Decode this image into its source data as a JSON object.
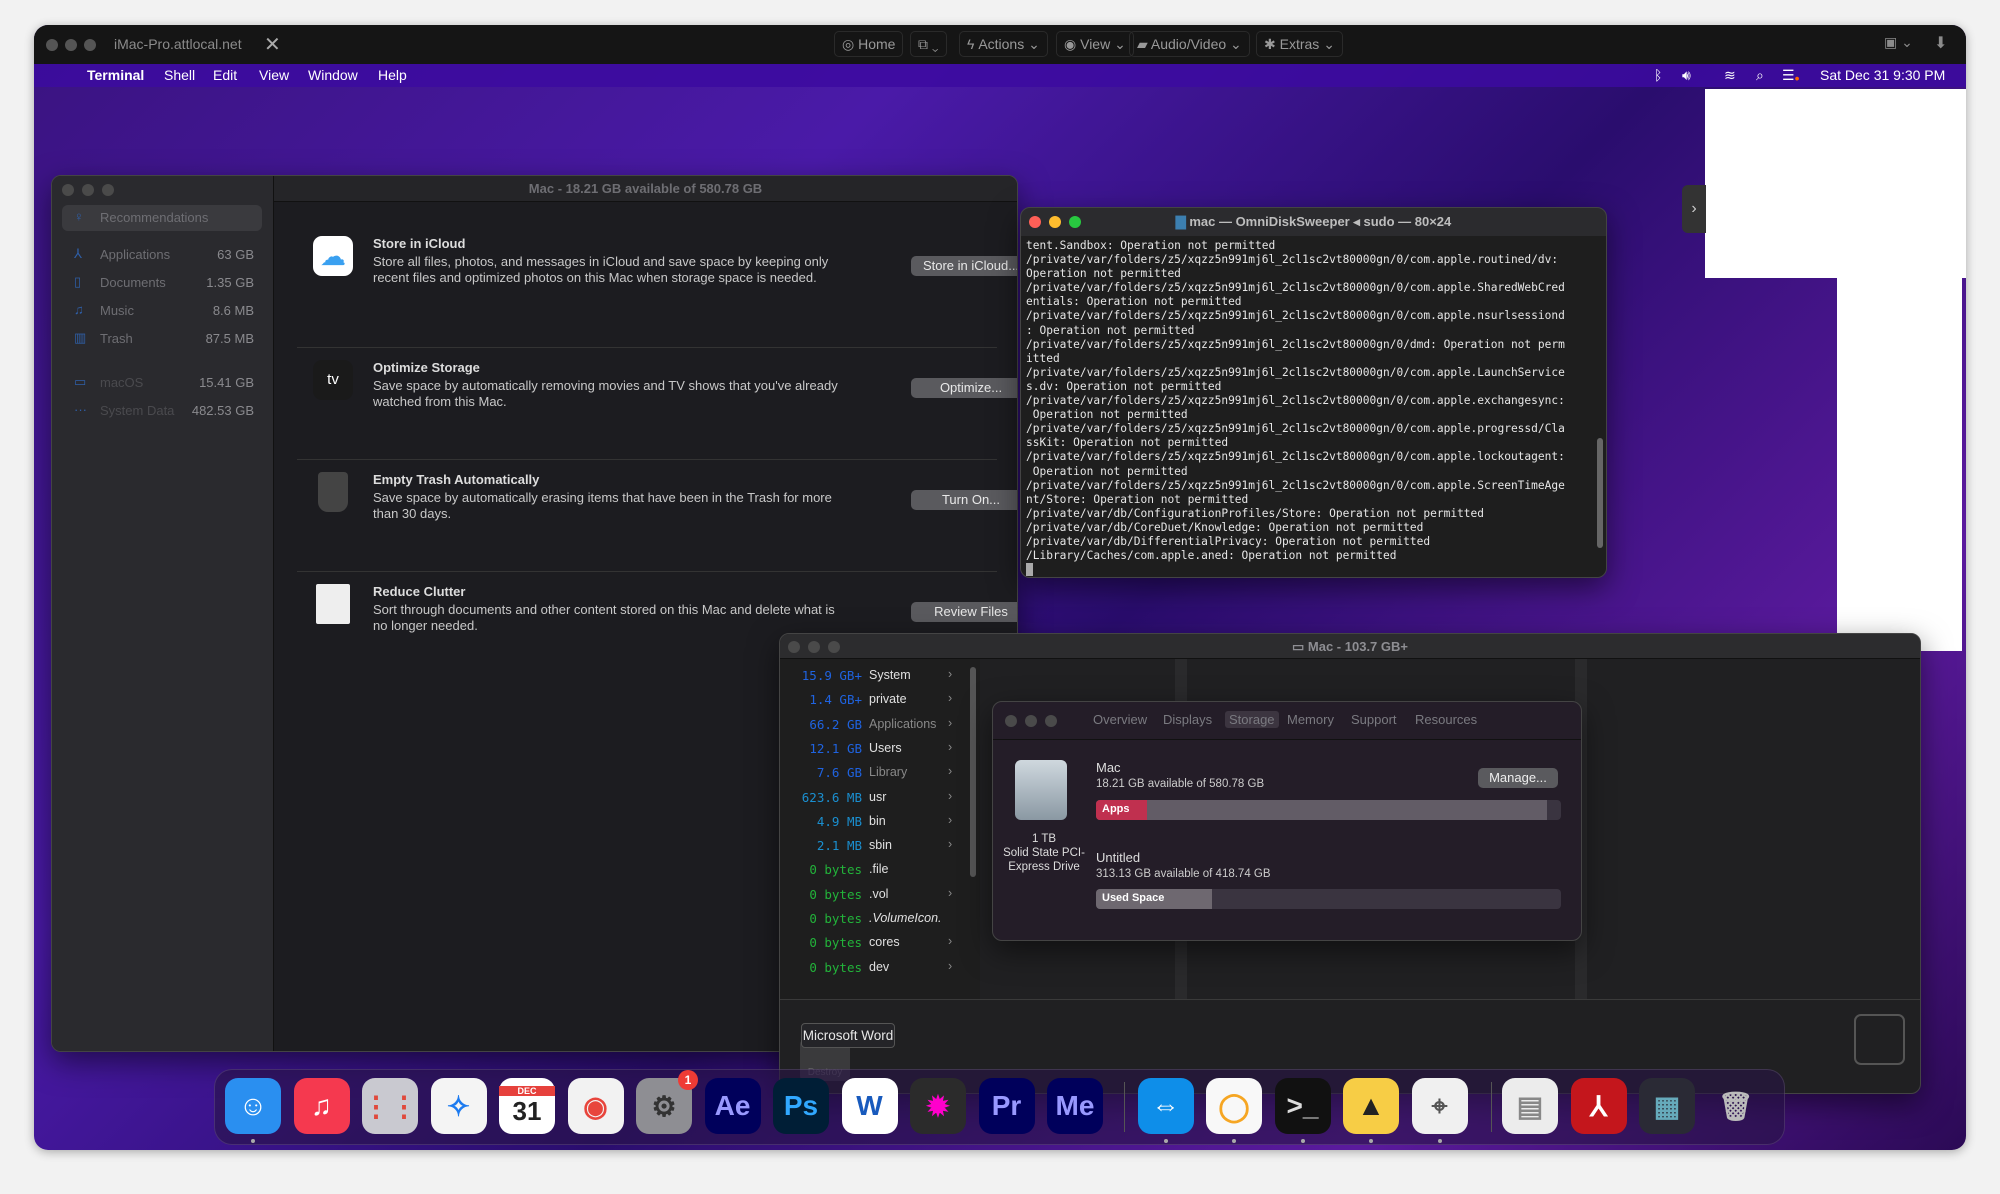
{
  "toolbar": {
    "host": "iMac-Pro.attlocal.net",
    "close_glyph": "✕",
    "home": "Home",
    "actions": "Actions",
    "view": "View",
    "audio_video": "Audio/Video",
    "extras": "Extras"
  },
  "menubar": {
    "app": "Terminal",
    "items": [
      "Shell",
      "Edit",
      "View",
      "Window",
      "Help"
    ],
    "clock": "Sat Dec 31  9:30 PM"
  },
  "storage_manager": {
    "title": "Mac - 18.21 GB available of 580.78 GB",
    "sidebar": [
      {
        "label": "Recommendations",
        "size": "",
        "icon": "lightbulb-icon"
      },
      {
        "label": "Applications",
        "size": "63 GB",
        "icon": "app-store-icon"
      },
      {
        "label": "Documents",
        "size": "1.35 GB",
        "icon": "document-icon"
      },
      {
        "label": "Music",
        "size": "8.6 MB",
        "icon": "music-note-icon"
      },
      {
        "label": "Trash",
        "size": "87.5 MB",
        "icon": "trash-icon"
      },
      {
        "label": "macOS",
        "size": "15.41 GB",
        "icon": "monitor-icon"
      },
      {
        "label": "System Data",
        "size": "482.53 GB",
        "icon": "ellipsis-icon"
      }
    ],
    "recommendations": [
      {
        "title": "Store in iCloud",
        "desc": "Store all files, photos, and messages in iCloud and save space by keeping only recent files and optimized photos on this Mac when storage space is needed.",
        "button": "Store in iCloud..."
      },
      {
        "title": "Optimize Storage",
        "desc": "Save space by automatically removing movies and TV shows that you've already watched from this Mac.",
        "button": "Optimize...",
        "icon_text": "tv"
      },
      {
        "title": "Empty Trash Automatically",
        "desc": "Save space by automatically erasing items that have been in the Trash for more than 30 days.",
        "button": "Turn On..."
      },
      {
        "title": "Reduce Clutter",
        "desc": "Sort through documents and other content stored on this Mac and delete what is no longer needed.",
        "button": "Review Files"
      }
    ]
  },
  "terminal": {
    "title": "mac — OmniDiskSweeper ◂ sudo — 80×24",
    "lines": [
      "tent.Sandbox: Operation not permitted",
      "/private/var/folders/z5/xqzz5n991mj6l_2cl1sc2vt80000gn/0/com.apple.routined/dv:",
      "Operation not permitted",
      "/private/var/folders/z5/xqzz5n991mj6l_2cl1sc2vt80000gn/0/com.apple.SharedWebCred",
      "entials: Operation not permitted",
      "/private/var/folders/z5/xqzz5n991mj6l_2cl1sc2vt80000gn/0/com.apple.nsurlsessiond",
      ": Operation not permitted",
      "/private/var/folders/z5/xqzz5n991mj6l_2cl1sc2vt80000gn/0/dmd: Operation not perm",
      "itted",
      "/private/var/folders/z5/xqzz5n991mj6l_2cl1sc2vt80000gn/0/com.apple.LaunchService",
      "s.dv: Operation not permitted",
      "/private/var/folders/z5/xqzz5n991mj6l_2cl1sc2vt80000gn/0/com.apple.exchangesync:",
      " Operation not permitted",
      "/private/var/folders/z5/xqzz5n991mj6l_2cl1sc2vt80000gn/0/com.apple.progressd/Cla",
      "ssKit: Operation not permitted",
      "/private/var/folders/z5/xqzz5n991mj6l_2cl1sc2vt80000gn/0/com.apple.lockoutagent:",
      " Operation not permitted",
      "/private/var/folders/z5/xqzz5n991mj6l_2cl1sc2vt80000gn/0/com.apple.ScreenTimeAge",
      "nt/Store: Operation not permitted",
      "/private/var/db/ConfigurationProfiles/Store: Operation not permitted",
      "/private/var/db/CoreDuet/Knowledge: Operation not permitted",
      "/private/var/db/DifferentialPrivacy: Operation not permitted",
      "/Library/Caches/com.apple.aned: Operation not permitted"
    ]
  },
  "omnidisksweeper": {
    "title": "Mac - 103.7 GB+",
    "rows": [
      {
        "size": "15.9 GB+",
        "name": "System",
        "color": "#1f63e0",
        "dim": false,
        "chevron": true
      },
      {
        "size": "1.4 GB+",
        "name": "private",
        "color": "#1f63e0",
        "dim": false,
        "chevron": true
      },
      {
        "size": "66.2 GB",
        "name": "Applications",
        "color": "#1f63e0",
        "dim": true,
        "chevron": true
      },
      {
        "size": "12.1 GB",
        "name": "Users",
        "color": "#1f63e0",
        "dim": false,
        "chevron": true
      },
      {
        "size": "7.6 GB",
        "name": "Library",
        "color": "#1f63e0",
        "dim": true,
        "chevron": true
      },
      {
        "size": "623.6 MB",
        "name": "usr",
        "color": "#1a8fd0",
        "dim": false,
        "chevron": true
      },
      {
        "size": "4.9 MB",
        "name": "bin",
        "color": "#1a8fd0",
        "dim": false,
        "chevron": true
      },
      {
        "size": "2.1 MB",
        "name": "sbin",
        "color": "#1a8fd0",
        "dim": false,
        "chevron": true
      },
      {
        "size": "0 bytes",
        "name": ".file",
        "color": "#22b33a",
        "dim": false,
        "chevron": false
      },
      {
        "size": "0 bytes",
        "name": ".vol",
        "color": "#22b33a",
        "dim": false,
        "chevron": true
      },
      {
        "size": "0 bytes",
        "name": ".VolumeIcon.",
        "color": "#22b33a",
        "dim": false,
        "chevron": false
      },
      {
        "size": "0 bytes",
        "name": "cores",
        "color": "#22b33a",
        "dim": false,
        "chevron": true
      },
      {
        "size": "0 bytes",
        "name": "dev",
        "color": "#22b33a",
        "dim": false,
        "chevron": true
      }
    ]
  },
  "about_mac": {
    "tabs": [
      "Overview",
      "Displays",
      "Storage",
      "Memory",
      "Support",
      "Resources"
    ],
    "active_tab": "Storage",
    "drive_caption": [
      "1 TB",
      "Solid State PCI-",
      "Express Drive"
    ],
    "volumes": [
      {
        "name": "Mac",
        "avail": "18.21 GB available of 580.78 GB",
        "bar_label": "Apps",
        "used_fraction": 0.97,
        "apps_fraction": 0.11,
        "color": "#c0304f"
      },
      {
        "name": "Untitled",
        "avail": "313.13 GB available of 418.74 GB",
        "bar_label": "Used Space",
        "used_fraction": 0.25
      }
    ],
    "manage": "Manage..."
  },
  "tooltip": "Microsoft Word",
  "dock": [
    {
      "name": "Finder",
      "glyph": "☺",
      "bg": "#2a8ff0",
      "fg": "#fff",
      "running": true
    },
    {
      "name": "Music",
      "glyph": "♫",
      "bg": "#f5394f",
      "fg": "#fff",
      "running": false
    },
    {
      "name": "Launchpad",
      "glyph": "⋮⋮",
      "bg": "#c9c9d0",
      "fg": "#e0493c",
      "running": false
    },
    {
      "name": "Safari",
      "glyph": "✧",
      "bg": "#f4f4f4",
      "fg": "#1d7bf0",
      "running": false
    },
    {
      "name": "Calendar",
      "glyph": "31",
      "bg": "#ffffff",
      "fg": "#222",
      "running": false,
      "month": "DEC"
    },
    {
      "name": "Chrome",
      "glyph": "◉",
      "bg": "#f2f2f2",
      "fg": "#e8453c",
      "running": false
    },
    {
      "name": "System Preferences",
      "glyph": "⚙",
      "bg": "#8e8e93",
      "fg": "#333",
      "running": false,
      "badge": "1"
    },
    {
      "name": "After Effects",
      "glyph": "Ae",
      "bg": "#00005b",
      "fg": "#9999ff",
      "running": false
    },
    {
      "name": "Photoshop",
      "glyph": "Ps",
      "bg": "#001e36",
      "fg": "#31a8ff",
      "running": false
    },
    {
      "name": "Microsoft Word",
      "glyph": "W",
      "bg": "#ffffff",
      "fg": "#185abd",
      "running": false
    },
    {
      "name": "Final Cut Pro",
      "glyph": "✹",
      "bg": "#2b2b2b",
      "fg": "#f0c",
      "running": false
    },
    {
      "name": "Premiere Pro",
      "glyph": "Pr",
      "bg": "#00005b",
      "fg": "#9999ff",
      "running": false
    },
    {
      "name": "Media Encoder",
      "glyph": "Me",
      "bg": "#00005b",
      "fg": "#9999ff",
      "running": false
    },
    {
      "name": "TeamViewer",
      "glyph": "⇔",
      "bg": "#0e8ee9",
      "fg": "#fff",
      "running": true
    },
    {
      "name": "Disk app",
      "glyph": "◯",
      "bg": "#f8f8f8",
      "fg": "#f6a623",
      "running": true
    },
    {
      "name": "Terminal",
      "glyph": ">_",
      "bg": "#111",
      "fg": "#ddd",
      "running": true
    },
    {
      "name": "Broom app",
      "glyph": "▲",
      "bg": "#f7cd45",
      "fg": "#222",
      "running": true
    },
    {
      "name": "System Information",
      "glyph": "⌖",
      "bg": "#f0f0f0",
      "fg": "#555",
      "running": true
    },
    {
      "name": "Document",
      "glyph": "▤",
      "bg": "#ececec",
      "fg": "#888",
      "running": false
    },
    {
      "name": "Acrobat folder",
      "glyph": "⅄",
      "bg": "#c4161c",
      "fg": "#fff",
      "running": false
    },
    {
      "name": "Screen window",
      "glyph": "▦",
      "bg": "#2a2a35",
      "fg": "#6ab",
      "running": false
    },
    {
      "name": "Trash",
      "glyph": "🗑",
      "bg": "transparent",
      "fg": "#bbb",
      "running": false
    }
  ]
}
